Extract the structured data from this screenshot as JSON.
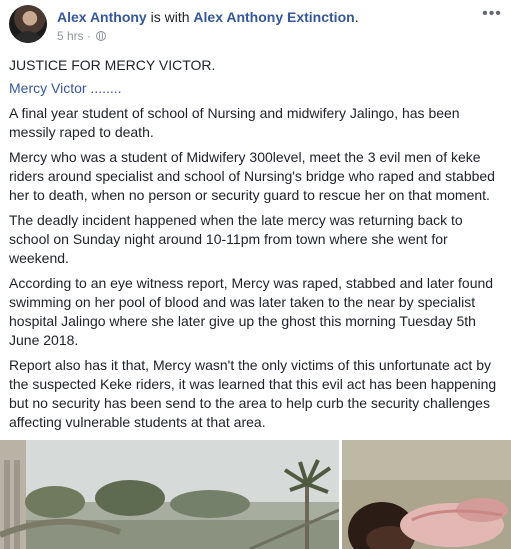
{
  "post": {
    "author": "Alex Anthony",
    "with_text": "is with",
    "tagged": "Alex Anthony Extinction",
    "period": ".",
    "time": "5 hrs",
    "separator": "·",
    "privacy_icon": "globe-icon",
    "more_icon": "more-options-icon",
    "more_glyph": "•••",
    "headline": "JUSTICE FOR MERCY VICTOR.",
    "mention": "Mercy Victor",
    "mention_suffix": " ........",
    "paragraphs": [
      "A final year student of school of Nursing and midwifery Jalingo, has been messily raped to death.",
      "Mercy who was a student of Midwifery 300level, meet the 3 evil men of keke riders around specialist and school of Nursing's bridge who raped and stabbed her to death, when no person or security guard to rescue her on that moment.",
      "The deadly incident happened when the late mercy was returning back to school on Sunday night around 10-11pm from town where she went for weekend.",
      "According to an eye witness report, Mercy was raped, stabbed and later found swimming on her pool of blood and was later taken to the near by specialist hospital Jalingo where she later give up the ghost this morning Tuesday 5th June 2018.",
      "Report also has it that, Mercy wasn't the only victims of this unfortunate act by the suspected Keke riders, it was learned that this evil act has been happening but no security has been send to the area to help curb the security challenges affecting vulnerable students at that area."
    ],
    "colors": {
      "link": "#365899",
      "text": "#1d2129",
      "meta": "#90949c"
    }
  }
}
